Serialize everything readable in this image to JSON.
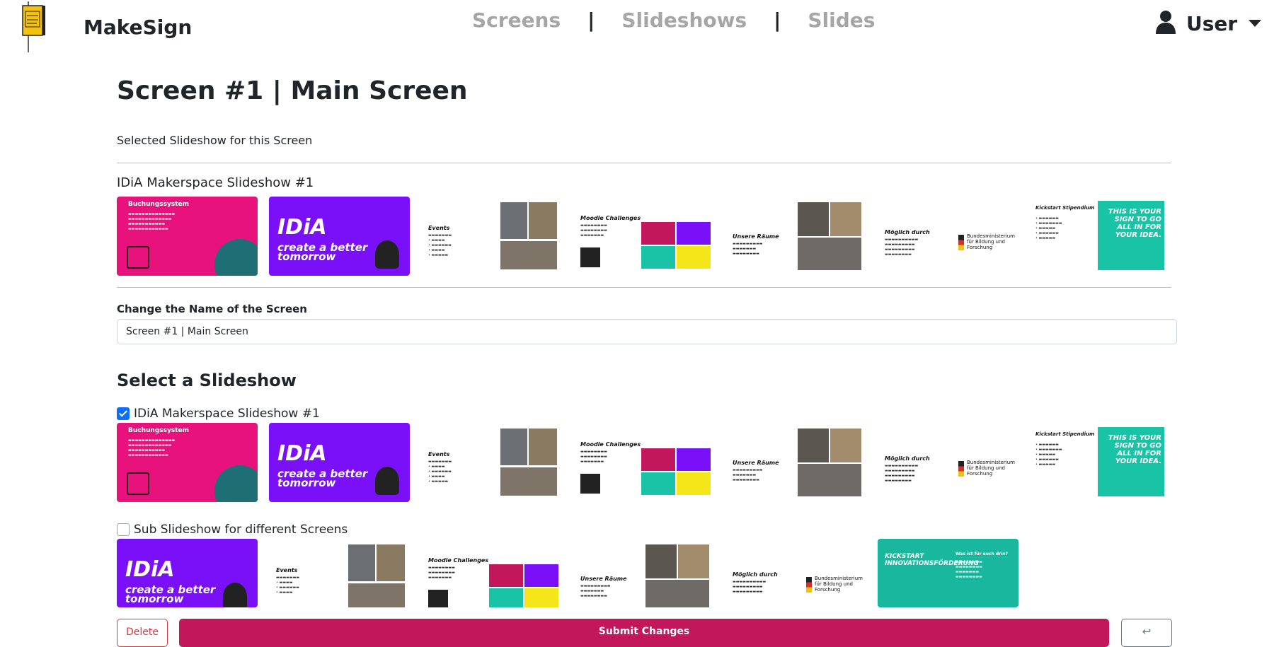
{
  "navbar": {
    "brand": "MakeSign",
    "links": [
      "Screens",
      "Slideshows",
      "Slides"
    ],
    "separator": "|",
    "user_label": "User"
  },
  "page": {
    "title": "Screen #1 | Main Screen",
    "selected_subtitle": "Selected Slideshow for this Screen",
    "selected_slideshow_name": "IDiA Makerspace Slideshow #1",
    "change_name_label": "Change the Name of the Screen",
    "name_input_value": "Screen #1 | Main Screen",
    "select_section_title": "Select a Slideshow"
  },
  "slideshows": [
    {
      "label": "IDiA Makerspace Slideshow #1",
      "checked": true
    },
    {
      "label": "Sub Slideshow for different Screens",
      "checked": false
    }
  ],
  "slide_text": {
    "buchung_title": "Buchungssystem",
    "idia_logo": "IDiA",
    "idia_tagline": "create a better tomorrow",
    "events_title": "Events",
    "moodle_title": "Moodle Challenges",
    "raeume_title": "Unsere Räume",
    "moeglich_title": "Möglich durch",
    "ministry_name": "Bundesministerium für Bildung und Forschung",
    "kickstart_title": "Kickstart Stipendium",
    "kickstart_poster": "THIS IS YOUR SIGN TO GO ALL IN FOR YOUR IDEA.",
    "kickstart_sub_title": "KICKSTART INNOVATIONSFÖRDERUNG",
    "kickstart_question": "Was ist für euch drin?"
  },
  "actions": {
    "delete_label": "Delete",
    "submit_label": "Submit Changes",
    "back_label": "↩"
  },
  "colors": {
    "pink": "#e8127c",
    "purple": "#7a10f7",
    "teal": "#19c3a6",
    "submit": "#c2185b",
    "delete": "#dc3545",
    "checkbox": "#0d6efd"
  }
}
